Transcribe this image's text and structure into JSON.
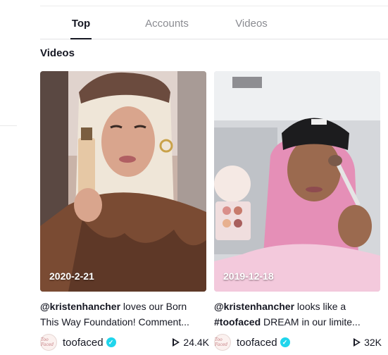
{
  "tabs": [
    {
      "label": "Top",
      "active": true
    },
    {
      "label": "Accounts",
      "active": false
    },
    {
      "label": "Videos",
      "active": false
    }
  ],
  "section_title": "Videos",
  "videos": [
    {
      "date": "2020-2-21",
      "mention": "@kristenhancher",
      "desc_line1_rest": " loves our Born",
      "desc_line2": "This Way Foundation! Comment...",
      "author": "toofaced",
      "views": "24.4K",
      "avatar_text": "Too Faced"
    },
    {
      "date": "2019-12-18",
      "mention": "@kristenhancher",
      "desc_line1_rest": " looks like a",
      "hashtag": "#toofaced",
      "desc_line2_rest": " DREAM in our limite...",
      "author": "toofaced",
      "views": "32K",
      "avatar_text": "Too Faced"
    }
  ],
  "icons": {
    "verified": "verified-check-icon",
    "views": "play-icon"
  },
  "colors": {
    "accent_verified": "#20d5ec",
    "text_primary": "#161823",
    "text_secondary": "#8a8b91"
  }
}
